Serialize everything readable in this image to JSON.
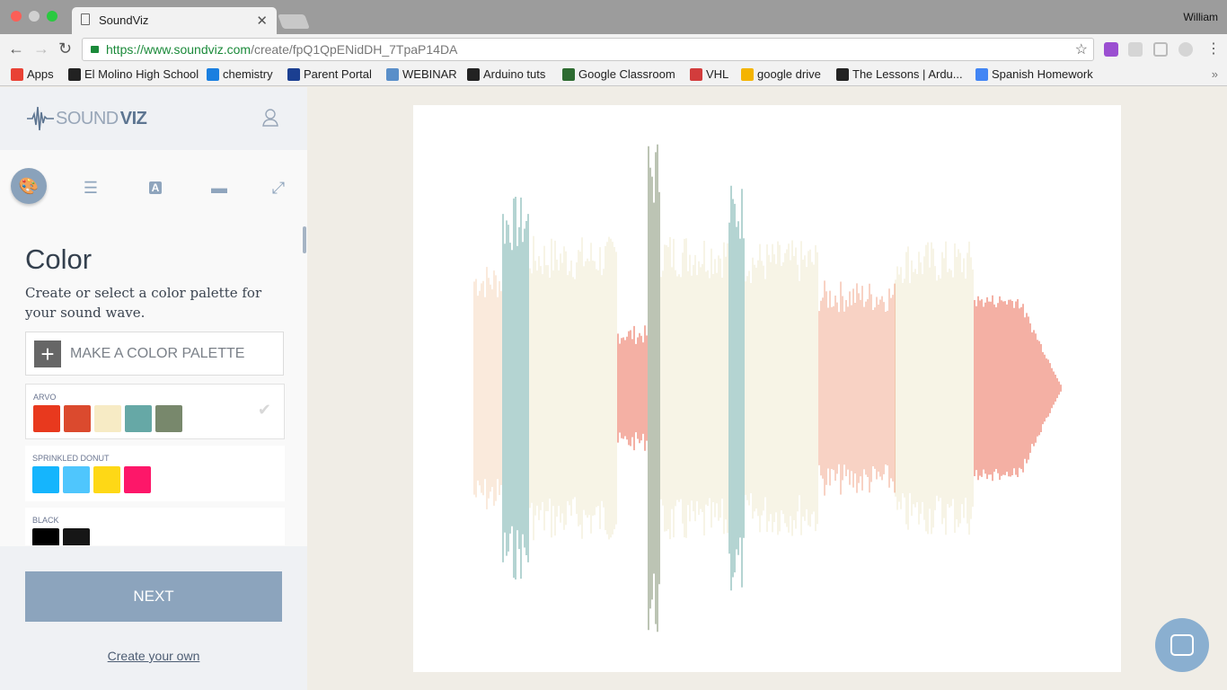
{
  "browser": {
    "tab_title": "SoundViz",
    "user": "William",
    "url_host": "https://www.soundviz.com",
    "url_path": "/create/fpQ1QpENidDH_7TpaP14DA",
    "bookmarks": [
      {
        "label": "Apps",
        "color": "#e94235"
      },
      {
        "label": "El Molino High School",
        "color": "#222222"
      },
      {
        "label": "chemistry",
        "color": "#1a7fe0"
      },
      {
        "label": "Parent Portal",
        "color": "#1b3f91"
      },
      {
        "label": "WEBINAR",
        "color": "#5a8fc9"
      },
      {
        "label": "Arduino tuts",
        "color": "#222222"
      },
      {
        "label": "Google Classroom",
        "color": "#2d6b31"
      },
      {
        "label": "VHL",
        "color": "#d23c3c"
      },
      {
        "label": "google drive",
        "color": "#f4b400"
      },
      {
        "label": "The Lessons | Ardu...",
        "color": "#222222"
      },
      {
        "label": "Spanish Homework",
        "color": "#4285f4"
      }
    ],
    "overflow": "»"
  },
  "app": {
    "logo_light": "SOUND",
    "logo_bold": "VIZ",
    "tools": [
      "palette-icon",
      "sliders-icon",
      "text-icon",
      "print-icon",
      "expand-icon"
    ],
    "title": "Color",
    "description": "Create or select a color palette for your sound wave.",
    "make_palette": "MAKE A COLOR PALETTE",
    "palettes": [
      {
        "name": "ARVO",
        "selected": true,
        "colors": [
          "#e8391e",
          "#db4a2e",
          "#f7ebc5",
          "#66a8a6",
          "#78886c"
        ]
      },
      {
        "name": "SPRINKLED DONUT",
        "selected": false,
        "colors": [
          "#15b5fd",
          "#4fc6fd",
          "#fed816",
          "#fd1769"
        ]
      },
      {
        "name": "BLACK",
        "selected": false,
        "colors": [
          "#000000",
          "#161616"
        ]
      }
    ],
    "next": "NEXT",
    "create_own": "Create your own"
  }
}
